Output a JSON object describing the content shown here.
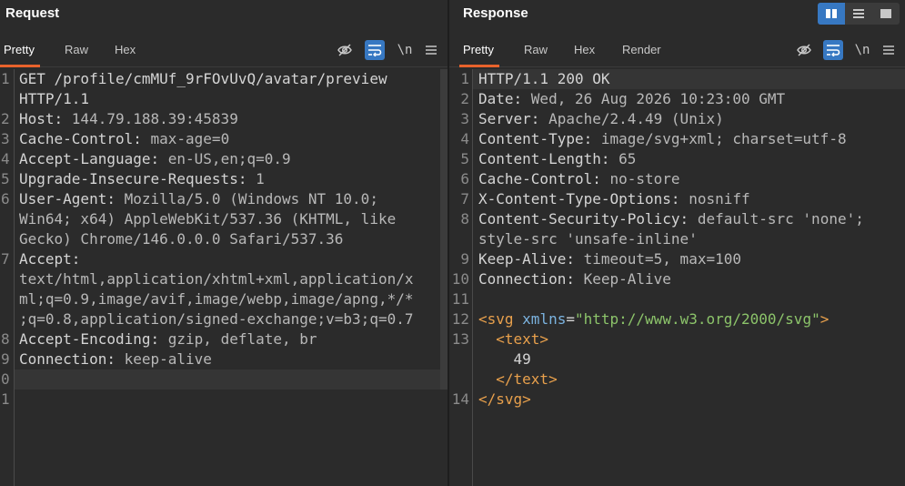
{
  "request": {
    "title": "Request",
    "tabs": [
      "Pretty",
      "Raw",
      "Hex"
    ],
    "icons": [
      "eye-slash-icon",
      "wrap-lines-icon",
      "newline-icon",
      "menu-icon"
    ],
    "newline_label": "\\n",
    "lines": [
      {
        "n": "1",
        "parts": [
          [
            "k",
            "GET /profile/cmMUf_9rFOvUvQ/avatar/preview"
          ]
        ]
      },
      {
        "n": "",
        "parts": [
          [
            "k",
            "HTTP/1.1"
          ]
        ]
      },
      {
        "n": "2",
        "parts": [
          [
            "k",
            "Host: "
          ],
          [
            "v",
            "144.79.188.39:45839"
          ]
        ]
      },
      {
        "n": "3",
        "parts": [
          [
            "k",
            "Cache-Control: "
          ],
          [
            "v",
            "max-age=0"
          ]
        ]
      },
      {
        "n": "4",
        "parts": [
          [
            "k",
            "Accept-Language: "
          ],
          [
            "v",
            "en-US,en;q=0.9"
          ]
        ]
      },
      {
        "n": "5",
        "parts": [
          [
            "k",
            "Upgrade-Insecure-Requests: "
          ],
          [
            "v",
            "1"
          ]
        ]
      },
      {
        "n": "6",
        "parts": [
          [
            "k",
            "User-Agent: "
          ],
          [
            "v",
            "Mozilla/5.0 (Windows NT 10.0;"
          ]
        ]
      },
      {
        "n": "",
        "parts": [
          [
            "v",
            "Win64; x64) AppleWebKit/537.36 (KHTML, like"
          ]
        ]
      },
      {
        "n": "",
        "parts": [
          [
            "v",
            "Gecko) Chrome/146.0.0.0 Safari/537.36"
          ]
        ]
      },
      {
        "n": "7",
        "parts": [
          [
            "k",
            "Accept:"
          ]
        ]
      },
      {
        "n": "",
        "parts": [
          [
            "v",
            "text/html,application/xhtml+xml,application/x"
          ]
        ]
      },
      {
        "n": "",
        "parts": [
          [
            "v",
            "ml;q=0.9,image/avif,image/webp,image/apng,*/*"
          ]
        ]
      },
      {
        "n": "",
        "parts": [
          [
            "v",
            ";q=0.8,application/signed-exchange;v=b3;q=0.7"
          ]
        ]
      },
      {
        "n": "8",
        "parts": [
          [
            "k",
            "Accept-Encoding: "
          ],
          [
            "v",
            "gzip, deflate, br"
          ]
        ]
      },
      {
        "n": "9",
        "parts": [
          [
            "k",
            "Connection: "
          ],
          [
            "v",
            "keep-alive"
          ]
        ]
      },
      {
        "n": "0",
        "parts": []
      },
      {
        "n": "1",
        "parts": []
      }
    ]
  },
  "response": {
    "title": "Response",
    "tabs": [
      "Pretty",
      "Raw",
      "Hex",
      "Render"
    ],
    "icons": [
      "eye-slash-icon",
      "wrap-lines-icon",
      "newline-icon",
      "menu-icon"
    ],
    "newline_label": "\\n",
    "lines": [
      {
        "n": "1",
        "parts": [
          [
            "k",
            "HTTP/1.1 200 OK"
          ]
        ]
      },
      {
        "n": "2",
        "parts": [
          [
            "k",
            "Date: "
          ],
          [
            "v",
            "Wed, 26 Aug 2026 10:23:00 GMT"
          ]
        ]
      },
      {
        "n": "3",
        "parts": [
          [
            "k",
            "Server: "
          ],
          [
            "v",
            "Apache/2.4.49 (Unix)"
          ]
        ]
      },
      {
        "n": "4",
        "parts": [
          [
            "k",
            "Content-Type: "
          ],
          [
            "v",
            "image/svg+xml; charset=utf-8"
          ]
        ]
      },
      {
        "n": "5",
        "parts": [
          [
            "k",
            "Content-Length: "
          ],
          [
            "v",
            "65"
          ]
        ]
      },
      {
        "n": "6",
        "parts": [
          [
            "k",
            "Cache-Control: "
          ],
          [
            "v",
            "no-store"
          ]
        ]
      },
      {
        "n": "7",
        "parts": [
          [
            "k",
            "X-Content-Type-Options: "
          ],
          [
            "v",
            "nosniff"
          ]
        ]
      },
      {
        "n": "8",
        "parts": [
          [
            "k",
            "Content-Security-Policy: "
          ],
          [
            "v",
            "default-src 'none';"
          ]
        ]
      },
      {
        "n": "",
        "parts": [
          [
            "v",
            "style-src 'unsafe-inline'"
          ]
        ]
      },
      {
        "n": "9",
        "parts": [
          [
            "k",
            "Keep-Alive: "
          ],
          [
            "v",
            "timeout=5, max=100"
          ]
        ]
      },
      {
        "n": "10",
        "parts": [
          [
            "k",
            "Connection: "
          ],
          [
            "v",
            "Keep-Alive"
          ]
        ]
      },
      {
        "n": "11",
        "parts": []
      },
      {
        "n": "12",
        "parts": [
          [
            "tag",
            "<svg "
          ],
          [
            "attr",
            "xmlns"
          ],
          [
            "k",
            "="
          ],
          [
            "str",
            "\"http://www.w3.org/2000/svg\""
          ],
          [
            "tag",
            ">"
          ]
        ]
      },
      {
        "n": "13",
        "parts": [
          [
            "k",
            "  "
          ],
          [
            "tag",
            "<text>"
          ]
        ]
      },
      {
        "n": "",
        "parts": [
          [
            "k",
            "    49"
          ]
        ]
      },
      {
        "n": "",
        "parts": [
          [
            "k",
            "  "
          ],
          [
            "tag",
            "</text>"
          ]
        ]
      },
      {
        "n": "14",
        "parts": [
          [
            "tag",
            "</svg>"
          ]
        ]
      }
    ]
  },
  "layout_buttons": [
    "split-vertical-icon",
    "split-horizontal-icon",
    "single-pane-icon"
  ]
}
